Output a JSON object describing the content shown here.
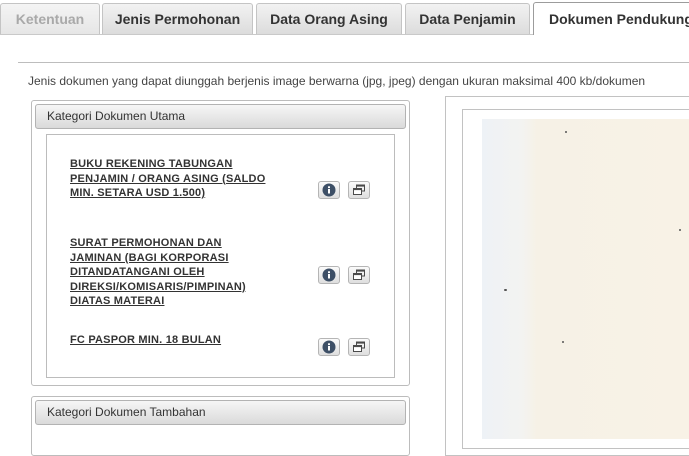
{
  "tabs": [
    {
      "label": "Ketentuan",
      "state": "disabled"
    },
    {
      "label": "Jenis Permohonan",
      "state": "normal"
    },
    {
      "label": "Data Orang Asing",
      "state": "normal"
    },
    {
      "label": "Data Penjamin",
      "state": "normal"
    },
    {
      "label": "Dokumen Pendukung",
      "state": "active"
    }
  ],
  "info_text": "Jenis dokumen yang dapat diunggah berjenis image berwarna (jpg, jpeg) dengan ukuran maksimal 400 kb/dokumen",
  "main_category": {
    "title": "Kategori Dokumen Utama",
    "documents": [
      {
        "label": "BUKU REKENING TABUNGAN PENJAMIN / ORANG ASING (SALDO MIN. SETARA USD 1.500)",
        "icons": [
          "info-icon",
          "open-window-icon"
        ]
      },
      {
        "label": "SURAT PERMOHONAN DAN JAMINAN (BAGI KORPORASI DITANDATANGANI OLEH DIREKSI/KOMISARIS/PIMPINAN) DIATAS MATERAI",
        "icons": [
          "info-icon",
          "open-window-icon"
        ]
      },
      {
        "label": "FC PASPOR MIN. 18 BULAN",
        "icons": [
          "info-icon",
          "open-window-icon"
        ]
      }
    ]
  },
  "additional_category": {
    "title": "Kategori Dokumen Tambahan"
  },
  "colors": {
    "info_button_fill": "#3d4f66",
    "preview_paper": "#f8f2e6"
  }
}
